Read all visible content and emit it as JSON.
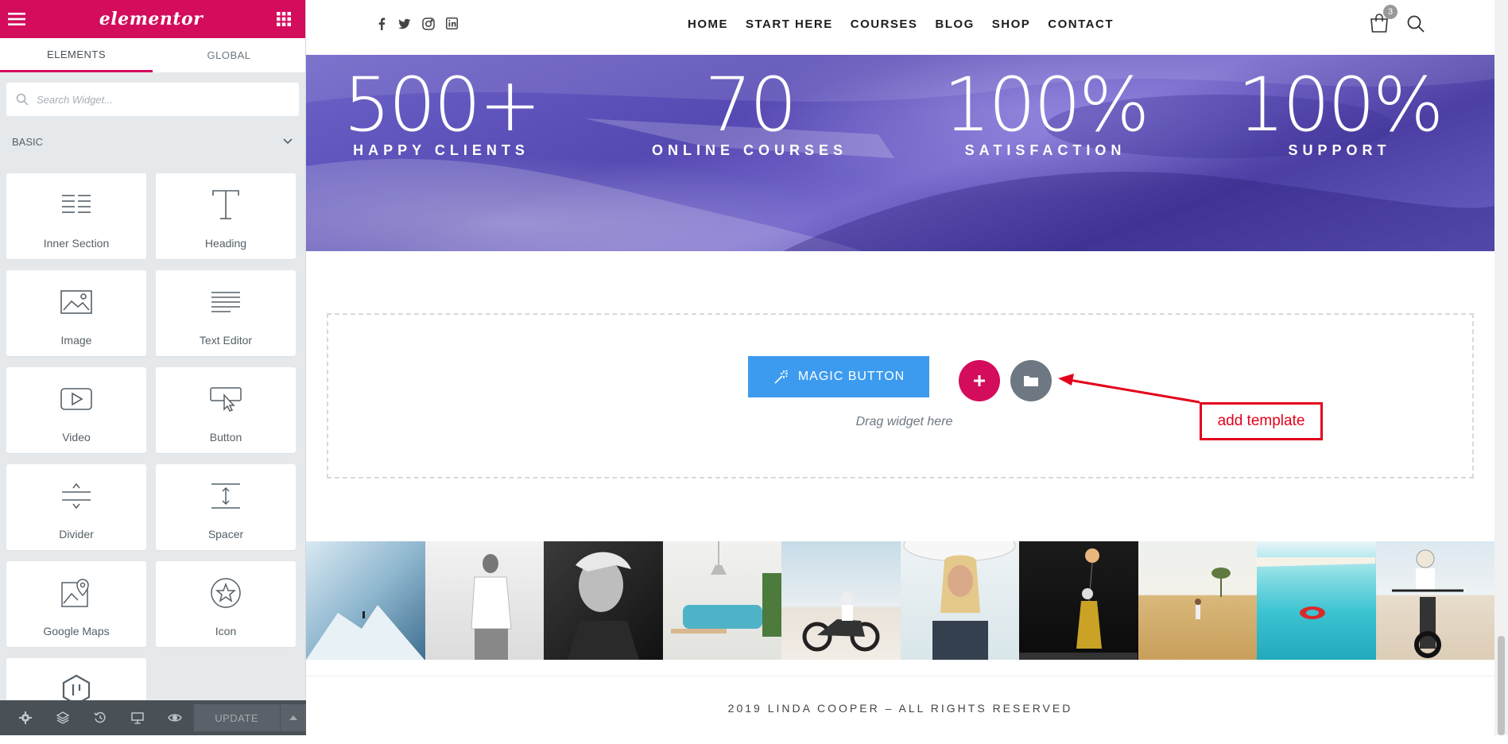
{
  "sidebar": {
    "logo": "elementor",
    "tabs": [
      "ELEMENTS",
      "GLOBAL"
    ],
    "search_placeholder": "Search Widget...",
    "category": "BASIC",
    "widgets": [
      "Inner Section",
      "Heading",
      "Image",
      "Text Editor",
      "Video",
      "Button",
      "Divider",
      "Spacer",
      "Google Maps",
      "Icon"
    ],
    "update_label": "UPDATE",
    "accent_color": "#d30c5c"
  },
  "site": {
    "nav": [
      "HOME",
      "START HERE",
      "COURSES",
      "BLOG",
      "SHOP",
      "CONTACT"
    ],
    "cart_count": "3",
    "stats": [
      {
        "num": "500+",
        "label": "HAPPY CLIENTS"
      },
      {
        "num": "70",
        "label": "ONLINE COURSES"
      },
      {
        "num": "100%",
        "label": "SATISFACTION"
      },
      {
        "num": "100%",
        "label": "SUPPORT"
      }
    ],
    "magic_button": "MAGIC BUTTON",
    "drag_hint": "Drag widget here",
    "copyright": "2019 LINDA COOPER – ALL RIGHTS RESERVED"
  },
  "annotation": {
    "label": "add template",
    "color": "#e3001b"
  }
}
